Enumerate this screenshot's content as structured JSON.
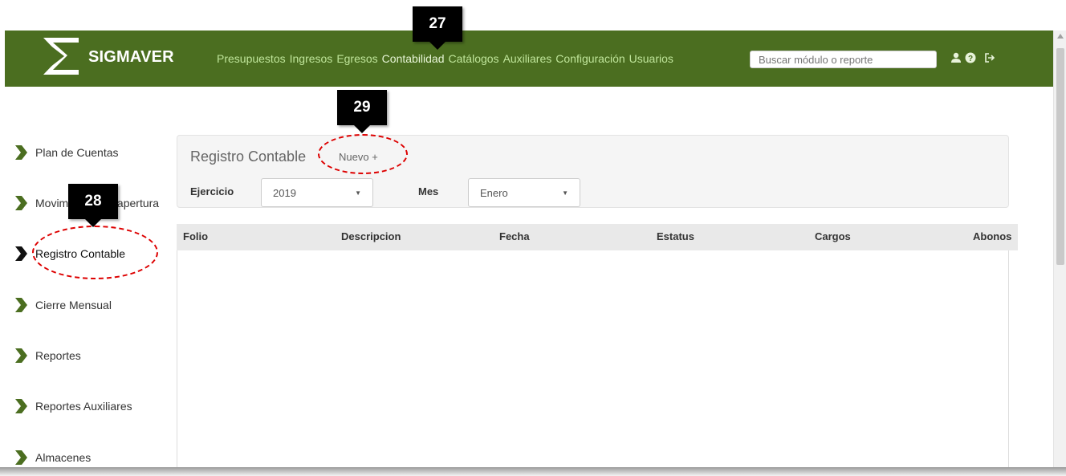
{
  "app": {
    "name": "SIGMAVER",
    "brand_color": "#4b6e20"
  },
  "nav": {
    "items": [
      {
        "label": "Presupuestos"
      },
      {
        "label": "Ingresos"
      },
      {
        "label": "Egresos"
      },
      {
        "label": "Contabilidad"
      },
      {
        "label": "Catálogos"
      },
      {
        "label": "Auxiliares"
      },
      {
        "label": "Configuración"
      },
      {
        "label": "Usuarios"
      }
    ],
    "active": "Contabilidad"
  },
  "search": {
    "placeholder": "Buscar módulo o reporte"
  },
  "header_icons": [
    "user-icon",
    "help-icon",
    "logout-icon"
  ],
  "sidebar": {
    "items": [
      {
        "label": "Plan de Cuentas"
      },
      {
        "label": "Movimientos de apertura"
      },
      {
        "label": "Registro Contable"
      },
      {
        "label": "Cierre Mensual"
      },
      {
        "label": "Reportes"
      },
      {
        "label": "Reportes Auxiliares"
      },
      {
        "label": "Almacenes"
      }
    ],
    "active": "Registro Contable"
  },
  "main": {
    "title": "Registro Contable",
    "new_label": "Nuevo +",
    "filters": {
      "ejercicio_label": "Ejercicio",
      "ejercicio_value": "2019",
      "mes_label": "Mes",
      "mes_value": "Enero"
    },
    "table": {
      "columns": [
        "Folio",
        "Descripcion",
        "Fecha",
        "Estatus",
        "Cargos",
        "Abonos"
      ],
      "rows": []
    }
  },
  "annotations": [
    {
      "number": "27",
      "target": "Contabilidad"
    },
    {
      "number": "28",
      "target": "Registro Contable"
    },
    {
      "number": "29",
      "target": "Nuevo +"
    }
  ]
}
